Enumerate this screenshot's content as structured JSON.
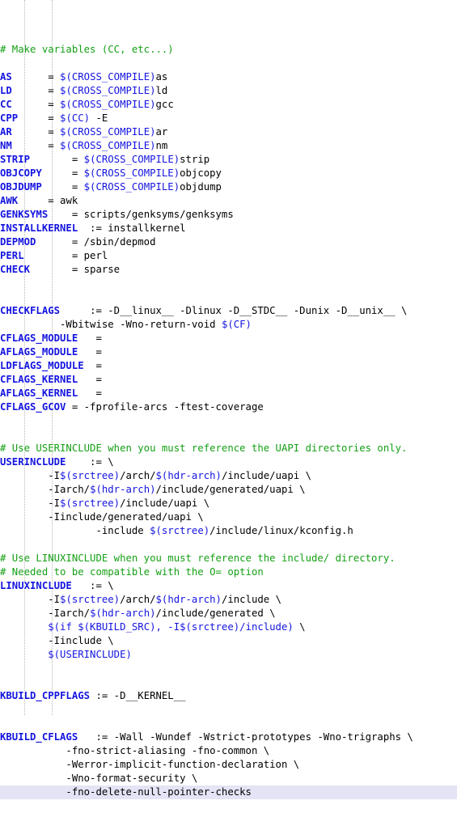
{
  "editor": {
    "title": "Makefile",
    "language": "makefile",
    "colors": {
      "background": "#ffffff",
      "comment": "#15a015",
      "variable": "#1414e0",
      "reference": "#1414e0",
      "text": "#000000",
      "current_line_highlight": "#e4e4f6",
      "indent_guide": "#b9b9b9"
    },
    "indent_guide_columns": [
      30,
      64
    ],
    "current_line_index": 51
  },
  "lines": [
    {
      "i": 0,
      "tokens": [
        {
          "k": "c",
          "s": "# Make variables (CC, etc...)"
        }
      ]
    },
    {
      "i": 1,
      "tokens": []
    },
    {
      "i": 2,
      "tokens": [
        {
          "k": "v",
          "s": "AS"
        },
        {
          "k": "t",
          "s": "      = "
        },
        {
          "k": "b",
          "s": "$(CROSS_COMPILE)"
        },
        {
          "k": "t",
          "s": "as"
        }
      ]
    },
    {
      "i": 3,
      "tokens": [
        {
          "k": "v",
          "s": "LD"
        },
        {
          "k": "t",
          "s": "      = "
        },
        {
          "k": "b",
          "s": "$(CROSS_COMPILE)"
        },
        {
          "k": "t",
          "s": "ld"
        }
      ]
    },
    {
      "i": 4,
      "tokens": [
        {
          "k": "v",
          "s": "CC"
        },
        {
          "k": "t",
          "s": "      = "
        },
        {
          "k": "b",
          "s": "$(CROSS_COMPILE)"
        },
        {
          "k": "t",
          "s": "gcc"
        }
      ]
    },
    {
      "i": 5,
      "tokens": [
        {
          "k": "v",
          "s": "CPP"
        },
        {
          "k": "t",
          "s": "     = "
        },
        {
          "k": "b",
          "s": "$(CC)"
        },
        {
          "k": "t",
          "s": " -E"
        }
      ]
    },
    {
      "i": 6,
      "tokens": [
        {
          "k": "v",
          "s": "AR"
        },
        {
          "k": "t",
          "s": "      = "
        },
        {
          "k": "b",
          "s": "$(CROSS_COMPILE)"
        },
        {
          "k": "t",
          "s": "ar"
        }
      ]
    },
    {
      "i": 7,
      "tokens": [
        {
          "k": "v",
          "s": "NM"
        },
        {
          "k": "t",
          "s": "      = "
        },
        {
          "k": "b",
          "s": "$(CROSS_COMPILE)"
        },
        {
          "k": "t",
          "s": "nm"
        }
      ]
    },
    {
      "i": 8,
      "tokens": [
        {
          "k": "v",
          "s": "STRIP"
        },
        {
          "k": "t",
          "s": "       = "
        },
        {
          "k": "b",
          "s": "$(CROSS_COMPILE)"
        },
        {
          "k": "t",
          "s": "strip"
        }
      ]
    },
    {
      "i": 9,
      "tokens": [
        {
          "k": "v",
          "s": "OBJCOPY"
        },
        {
          "k": "t",
          "s": "     = "
        },
        {
          "k": "b",
          "s": "$(CROSS_COMPILE)"
        },
        {
          "k": "t",
          "s": "objcopy"
        }
      ]
    },
    {
      "i": 10,
      "tokens": [
        {
          "k": "v",
          "s": "OBJDUMP"
        },
        {
          "k": "t",
          "s": "     = "
        },
        {
          "k": "b",
          "s": "$(CROSS_COMPILE)"
        },
        {
          "k": "t",
          "s": "objdump"
        }
      ]
    },
    {
      "i": 11,
      "tokens": [
        {
          "k": "v",
          "s": "AWK"
        },
        {
          "k": "t",
          "s": "     = awk"
        }
      ]
    },
    {
      "i": 12,
      "tokens": [
        {
          "k": "v",
          "s": "GENKSYMS"
        },
        {
          "k": "t",
          "s": "    = scripts/genksyms/genksyms"
        }
      ]
    },
    {
      "i": 13,
      "tokens": [
        {
          "k": "v",
          "s": "INSTALLKERNEL"
        },
        {
          "k": "t",
          "s": "  := installkernel"
        }
      ]
    },
    {
      "i": 14,
      "tokens": [
        {
          "k": "v",
          "s": "DEPMOD"
        },
        {
          "k": "t",
          "s": "      = /sbin/depmod"
        }
      ]
    },
    {
      "i": 15,
      "tokens": [
        {
          "k": "v",
          "s": "PERL"
        },
        {
          "k": "t",
          "s": "        = perl"
        }
      ]
    },
    {
      "i": 16,
      "tokens": [
        {
          "k": "v",
          "s": "CHECK"
        },
        {
          "k": "t",
          "s": "       = sparse"
        }
      ]
    },
    {
      "i": 17,
      "tokens": []
    },
    {
      "i": 18,
      "tokens": []
    },
    {
      "i": 19,
      "tokens": [
        {
          "k": "v",
          "s": "CHECKFLAGS"
        },
        {
          "k": "t",
          "s": "     := -D__linux__ -Dlinux -D__STDC__ -Dunix -D__unix__ \\"
        }
      ]
    },
    {
      "i": 20,
      "tokens": [
        {
          "k": "t",
          "s": "          -Wbitwise -Wno-return-void "
        },
        {
          "k": "b",
          "s": "$(CF)"
        }
      ]
    },
    {
      "i": 21,
      "tokens": [
        {
          "k": "v",
          "s": "CFLAGS_MODULE"
        },
        {
          "k": "t",
          "s": "   ="
        }
      ]
    },
    {
      "i": 22,
      "tokens": [
        {
          "k": "v",
          "s": "AFLAGS_MODULE"
        },
        {
          "k": "t",
          "s": "   ="
        }
      ]
    },
    {
      "i": 23,
      "tokens": [
        {
          "k": "v",
          "s": "LDFLAGS_MODULE"
        },
        {
          "k": "t",
          "s": "  ="
        }
      ]
    },
    {
      "i": 24,
      "tokens": [
        {
          "k": "v",
          "s": "CFLAGS_KERNEL"
        },
        {
          "k": "t",
          "s": "   ="
        }
      ]
    },
    {
      "i": 25,
      "tokens": [
        {
          "k": "v",
          "s": "AFLAGS_KERNEL"
        },
        {
          "k": "t",
          "s": "   ="
        }
      ]
    },
    {
      "i": 26,
      "tokens": [
        {
          "k": "v",
          "s": "CFLAGS_GCOV"
        },
        {
          "k": "t",
          "s": " = -fprofile-arcs -ftest-coverage"
        }
      ]
    },
    {
      "i": 27,
      "tokens": []
    },
    {
      "i": 28,
      "tokens": []
    },
    {
      "i": 29,
      "tokens": [
        {
          "k": "c",
          "s": "# Use USERINCLUDE when you must reference the UAPI directories only."
        }
      ]
    },
    {
      "i": 30,
      "tokens": [
        {
          "k": "v",
          "s": "USERINCLUDE"
        },
        {
          "k": "t",
          "s": "    := \\"
        }
      ]
    },
    {
      "i": 31,
      "tokens": [
        {
          "k": "t",
          "s": "        -I"
        },
        {
          "k": "b",
          "s": "$(srctree)"
        },
        {
          "k": "t",
          "s": "/arch/"
        },
        {
          "k": "b",
          "s": "$(hdr-arch)"
        },
        {
          "k": "t",
          "s": "/include/uapi \\"
        }
      ]
    },
    {
      "i": 32,
      "tokens": [
        {
          "k": "t",
          "s": "        -Iarch/"
        },
        {
          "k": "b",
          "s": "$(hdr-arch)"
        },
        {
          "k": "t",
          "s": "/include/generated/uapi \\"
        }
      ]
    },
    {
      "i": 33,
      "tokens": [
        {
          "k": "t",
          "s": "        -I"
        },
        {
          "k": "b",
          "s": "$(srctree)"
        },
        {
          "k": "t",
          "s": "/include/uapi \\"
        }
      ]
    },
    {
      "i": 34,
      "tokens": [
        {
          "k": "t",
          "s": "        -Iinclude/generated/uapi \\"
        }
      ]
    },
    {
      "i": 35,
      "tokens": [
        {
          "k": "t",
          "s": "                -include "
        },
        {
          "k": "b",
          "s": "$(srctree)"
        },
        {
          "k": "t",
          "s": "/include/linux/kconfig.h"
        }
      ]
    },
    {
      "i": 36,
      "tokens": []
    },
    {
      "i": 37,
      "tokens": [
        {
          "k": "c",
          "s": "# Use LINUXINCLUDE when you must reference the include/ directory."
        }
      ]
    },
    {
      "i": 38,
      "tokens": [
        {
          "k": "c",
          "s": "# Needed to be compatible with the O= option"
        }
      ]
    },
    {
      "i": 39,
      "tokens": [
        {
          "k": "v",
          "s": "LINUXINCLUDE"
        },
        {
          "k": "t",
          "s": "   := \\"
        }
      ]
    },
    {
      "i": 40,
      "tokens": [
        {
          "k": "t",
          "s": "        -I"
        },
        {
          "k": "b",
          "s": "$(srctree)"
        },
        {
          "k": "t",
          "s": "/arch/"
        },
        {
          "k": "b",
          "s": "$(hdr-arch)"
        },
        {
          "k": "t",
          "s": "/include \\"
        }
      ]
    },
    {
      "i": 41,
      "tokens": [
        {
          "k": "t",
          "s": "        -Iarch/"
        },
        {
          "k": "b",
          "s": "$(hdr-arch)"
        },
        {
          "k": "t",
          "s": "/include/generated \\"
        }
      ]
    },
    {
      "i": 42,
      "tokens": [
        {
          "k": "t",
          "s": "        "
        },
        {
          "k": "b",
          "s": "$(if $(KBUILD_SRC), -I$(srctree)/include)"
        },
        {
          "k": "t",
          "s": " \\"
        }
      ]
    },
    {
      "i": 43,
      "tokens": [
        {
          "k": "t",
          "s": "        -Iinclude \\"
        }
      ]
    },
    {
      "i": 44,
      "tokens": [
        {
          "k": "t",
          "s": "        "
        },
        {
          "k": "b",
          "s": "$(USERINCLUDE)"
        }
      ]
    },
    {
      "i": 45,
      "tokens": []
    },
    {
      "i": 46,
      "tokens": []
    },
    {
      "i": 47,
      "tokens": [
        {
          "k": "v",
          "s": "KBUILD_CPPFLAGS"
        },
        {
          "k": "t",
          "s": " := -D__KERNEL__"
        }
      ]
    },
    {
      "i": 48,
      "tokens": []
    },
    {
      "i": 49,
      "tokens": []
    },
    {
      "i": 50,
      "tokens": [
        {
          "k": "v",
          "s": "KBUILD_CFLAGS"
        },
        {
          "k": "t",
          "s": "   := -Wall -Wundef -Wstrict-prototypes -Wno-trigraphs \\"
        }
      ]
    },
    {
      "i": 51,
      "tokens": [
        {
          "k": "t",
          "s": "           -fno-strict-aliasing -fno-common \\"
        }
      ]
    },
    {
      "i": 52,
      "tokens": [
        {
          "k": "t",
          "s": "           -Werror-implicit-function-declaration \\"
        }
      ]
    },
    {
      "i": 53,
      "tokens": [
        {
          "k": "t",
          "s": "           -Wno-format-security \\"
        }
      ]
    },
    {
      "i": 54,
      "tokens": [
        {
          "k": "t",
          "s": "           -fno-delete-null-pointer-checks"
        }
      ],
      "highlight": true
    }
  ]
}
